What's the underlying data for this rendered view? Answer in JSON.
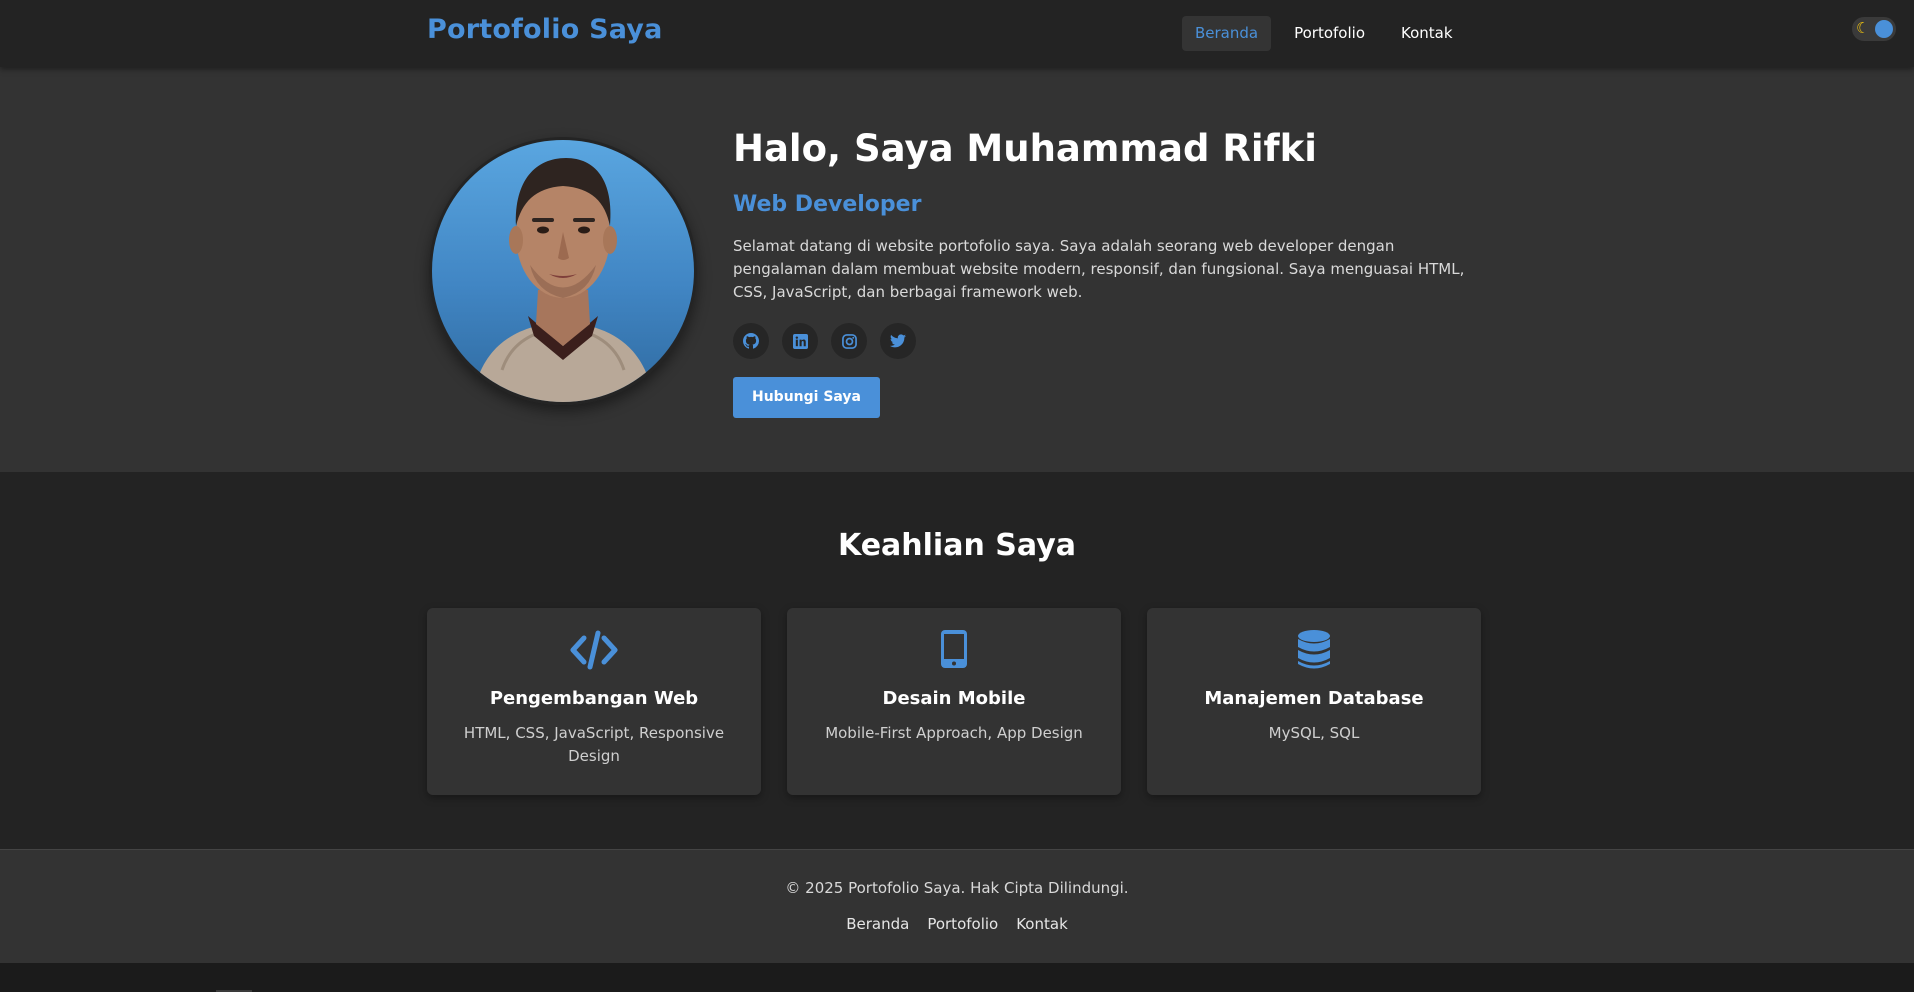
{
  "navbar": {
    "brand": "Portofolio Saya",
    "links": [
      {
        "label": "Beranda",
        "active": true
      },
      {
        "label": "Portofolio",
        "active": false
      },
      {
        "label": "Kontak",
        "active": false
      }
    ],
    "theme_toggle": {
      "icon": "moon-icon",
      "state": "dark"
    }
  },
  "hero": {
    "title": "Halo, Saya Muhammad Rifki",
    "subtitle": "Web Developer",
    "description": "Selamat datang di website portofolio saya. Saya adalah seorang web developer dengan pengalaman dalam membuat website modern, responsif, dan fungsional. Saya menguasai HTML, CSS, JavaScript, dan berbagai framework web.",
    "socials": [
      "github-icon",
      "linkedin-icon",
      "instagram-icon",
      "twitter-icon"
    ],
    "cta_label": "Hubungi Saya"
  },
  "skills": {
    "title": "Keahlian Saya",
    "items": [
      {
        "icon": "code-icon",
        "title": "Pengembangan Web",
        "desc": "HTML, CSS, JavaScript, Responsive Design"
      },
      {
        "icon": "mobile-icon",
        "title": "Desain Mobile",
        "desc": "Mobile-First Approach, App Design"
      },
      {
        "icon": "database-icon",
        "title": "Manajemen Database",
        "desc": "MySQL, SQL"
      }
    ]
  },
  "footer": {
    "copyright": "© 2025 Portofolio Saya. Hak Cipta Dilindungi.",
    "links": [
      "Beranda",
      "Portofolio",
      "Kontak"
    ]
  },
  "colors": {
    "accent": "#4a90d9",
    "background": "#1a1a1a",
    "surface": "#333333",
    "navbar": "#232323"
  }
}
